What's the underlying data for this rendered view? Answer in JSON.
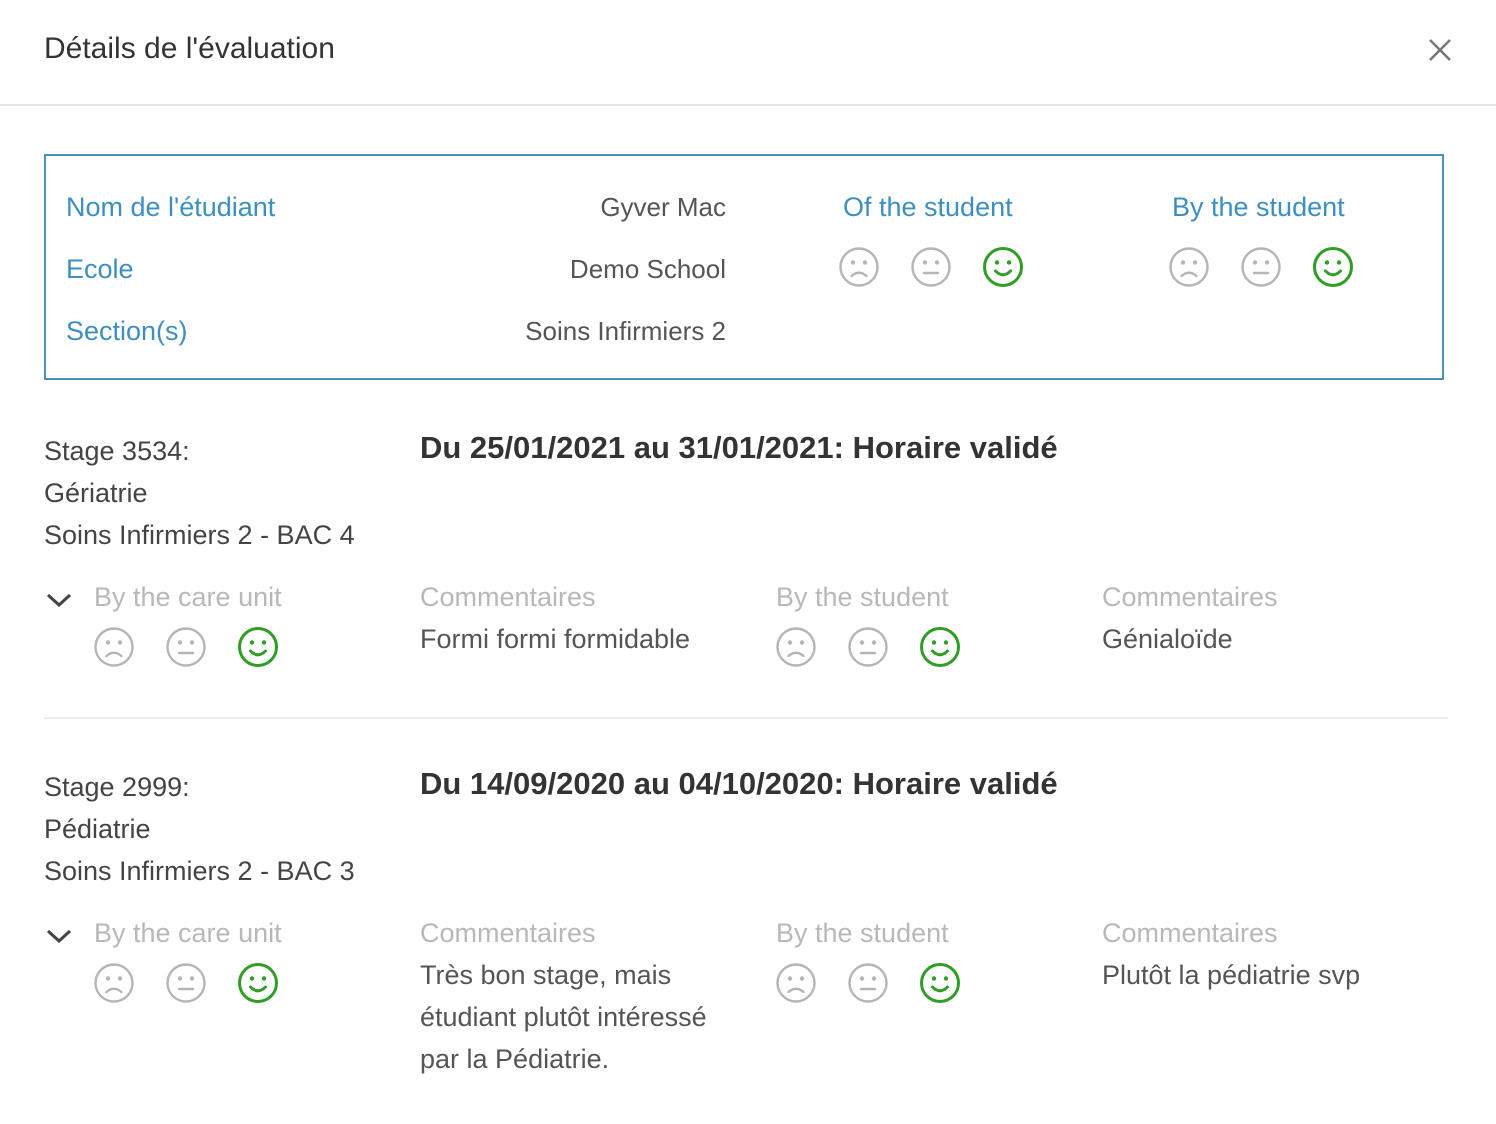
{
  "modal": {
    "title": "Détails de l'évaluation",
    "close_icon": "close-icon"
  },
  "colors": {
    "accent": "#3d8fc0",
    "positive": "#2e9e24",
    "neutral_face": "#b5b5b5",
    "muted_label": "#b8b8b8"
  },
  "student": {
    "name_label": "Nom de l'étudiant",
    "name_value": "Gyver Mac",
    "school_label": "Ecole",
    "school_value": "Demo School",
    "sections_label": "Section(s)",
    "sections_value": "Soins Infirmiers 2",
    "of_student_label": "Of the student",
    "of_student_rating": "happy",
    "by_student_label": "By the student",
    "by_student_rating": "happy"
  },
  "stages": [
    {
      "title_line1": "Stage 3534:",
      "title_line2": "Gériatrie",
      "title_line3": "Soins Infirmiers 2 - BAC 4",
      "period": "Du 25/01/2021 au 31/01/2021: Horaire validé",
      "care_unit_label": "By the care unit",
      "care_unit_rating": "happy",
      "care_unit_comment_label": "Commentaires",
      "care_unit_comment": "Formi formi formidable",
      "student_label": "By the student",
      "student_rating": "happy",
      "student_comment_label": "Commentaires",
      "student_comment": "Génialoïde"
    },
    {
      "title_line1": "Stage 2999:",
      "title_line2": "Pédiatrie",
      "title_line3": "Soins Infirmiers 2 - BAC 3",
      "period": "Du 14/09/2020 au 04/10/2020: Horaire validé",
      "care_unit_label": "By the care unit",
      "care_unit_rating": "happy",
      "care_unit_comment_label": "Commentaires",
      "care_unit_comment_lines": [
        "Très bon stage, mais",
        "étudiant plutôt intéressé",
        "par la Pédiatrie."
      ],
      "student_label": "By the student",
      "student_rating": "happy",
      "student_comment_label": "Commentaires",
      "student_comment": "Plutôt la pédiatrie svp"
    }
  ]
}
